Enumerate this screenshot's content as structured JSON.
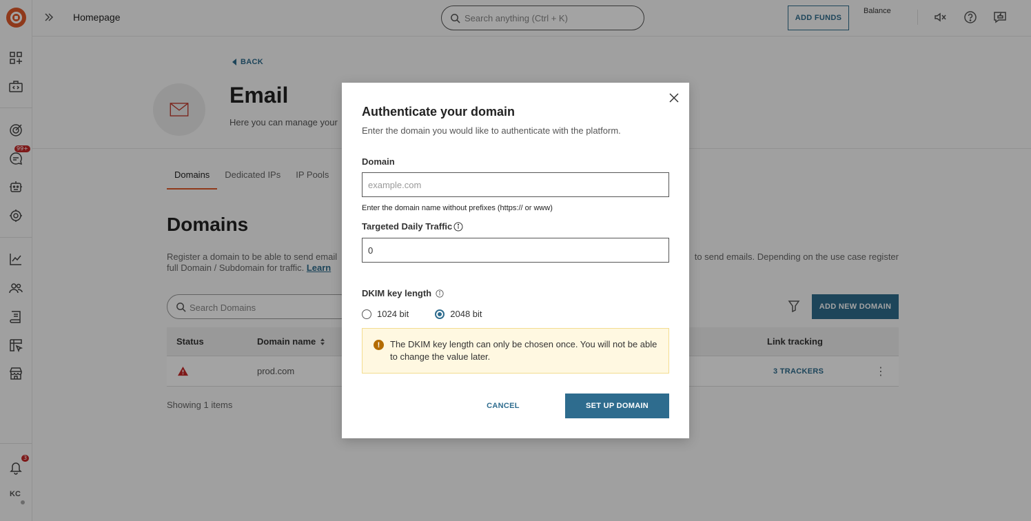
{
  "topbar": {
    "breadcrumb": "Homepage",
    "search_placeholder": "Search anything (Ctrl + K)",
    "add_funds_label": "ADD FUNDS",
    "balance_label": "Balance"
  },
  "sidebar": {
    "chat_badge": "99+",
    "notifications_badge": "3",
    "avatar_initials": "KC"
  },
  "page": {
    "back_label": "BACK",
    "title": "Email",
    "subtitle": "Here you can manage your",
    "tabs": [
      "Domains",
      "Dedicated IPs",
      "IP Pools"
    ],
    "section_title": "Domains",
    "desc_left_1": "Register a domain to be able to send email",
    "desc_left_2": "full Domain / Subdomain for traffic.",
    "learn_link": "Learn",
    "desc_right": "to send emails. Depending on the use case register",
    "search_placeholder": "Search Domains",
    "add_domain_label": "ADD NEW DOMAIN",
    "table": {
      "headers": {
        "status": "Status",
        "domain_name": "Domain name",
        "link_tracking": "Link tracking"
      },
      "rows": [
        {
          "domain": "prod.com",
          "link_tracking": "3 TRACKERS"
        }
      ]
    },
    "showing": "Showing 1 items"
  },
  "modal": {
    "title": "Authenticate your domain",
    "description": "Enter the domain you would like to authenticate with the platform.",
    "domain_label": "Domain",
    "domain_placeholder": "example.com",
    "domain_value": "",
    "domain_helper": "Enter the domain name without prefixes (https:// or www)",
    "traffic_label": "Targeted Daily Traffic",
    "traffic_value": "0",
    "dkim_label": "DKIM key length",
    "dkim_options": [
      "1024 bit",
      "2048 bit"
    ],
    "dkim_selected": "2048 bit",
    "warning_text": "The DKIM key length can only be chosen once. You will not be able to change the value later.",
    "cancel_label": "CANCEL",
    "submit_label": "SET UP DOMAIN"
  },
  "colors": {
    "brand": "#e05a2b",
    "accent": "#2e6c8e",
    "warning_bg": "#fff8e1",
    "danger": "#c62828"
  }
}
